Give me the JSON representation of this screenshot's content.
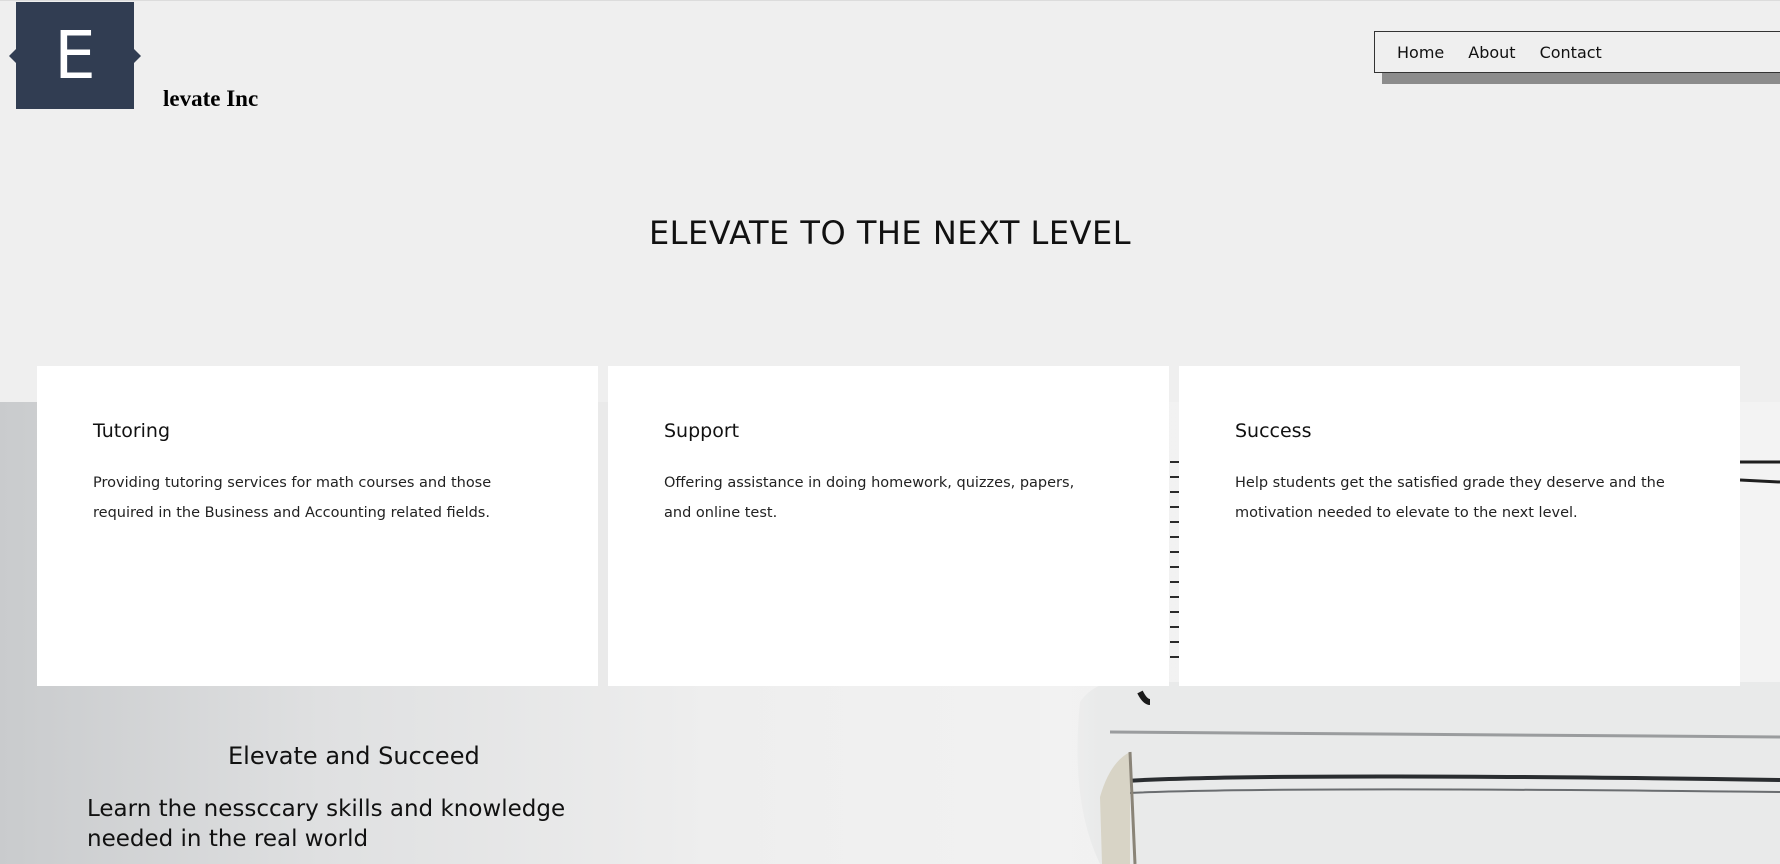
{
  "brand": {
    "logo_letter": "E",
    "name": "levate Inc"
  },
  "nav": {
    "items": [
      {
        "label": "Home"
      },
      {
        "label": "About"
      },
      {
        "label": "Contact"
      }
    ]
  },
  "hero": {
    "title": "ELEVATE TO THE NEXT LEVEL"
  },
  "cards": [
    {
      "title": "Tutoring",
      "text": "Providing tutoring services for math courses and those required in the Business and Accounting related fields."
    },
    {
      "title": "Support",
      "text": "Offering assistance in doing homework, quizzes, papers, and online test."
    },
    {
      "title": "Success",
      "text": "Help students get the satisfied grade they deserve and the motivation needed to elevate to the next level."
    }
  ],
  "section": {
    "heading": "Elevate and Succeed",
    "subtext": "Learn the nessccary skills and knowledge needed in the real world"
  },
  "colors": {
    "logo_bg": "#313d52",
    "page_bg": "#efefef",
    "card_bg": "#ffffff"
  }
}
